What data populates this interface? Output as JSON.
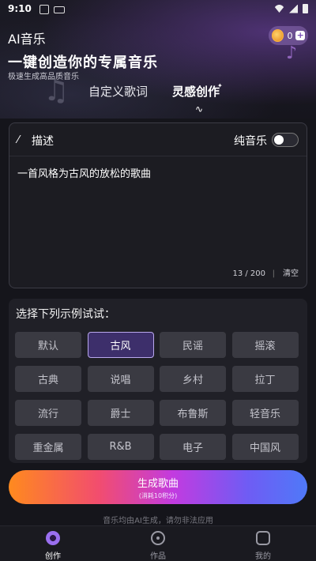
{
  "status_bar": {
    "time": "9:10"
  },
  "header": {
    "app_title": "AI音乐",
    "coins": "0",
    "headline": "一键创造你的专属音乐",
    "subline": "极速生成高品质音乐"
  },
  "tabs": [
    {
      "label": "自定义歌词"
    },
    {
      "label": "灵感创作"
    }
  ],
  "description": {
    "label": "描述",
    "pure_music_label": "纯音乐",
    "text": "一首风格为古风的放松的歌曲",
    "counter": "13 / 200",
    "divider": "|",
    "clear_label": "清空"
  },
  "examples": {
    "title": "选择下列示例试试：",
    "chips": [
      "默认",
      "古风",
      "民谣",
      "摇滚",
      "古典",
      "说唱",
      "乡村",
      "拉丁",
      "流行",
      "爵士",
      "布鲁斯",
      "轻音乐",
      "重金属",
      "R&B",
      "电子",
      "中国风"
    ],
    "selected": "古风"
  },
  "generate": {
    "label": "生成歌曲",
    "sub": "(消耗10积分)"
  },
  "footnote": "音乐均由AI生成，请勿非法应用",
  "bottom_nav": [
    {
      "label": "创作"
    },
    {
      "label": "作品"
    },
    {
      "label": "我的"
    }
  ]
}
